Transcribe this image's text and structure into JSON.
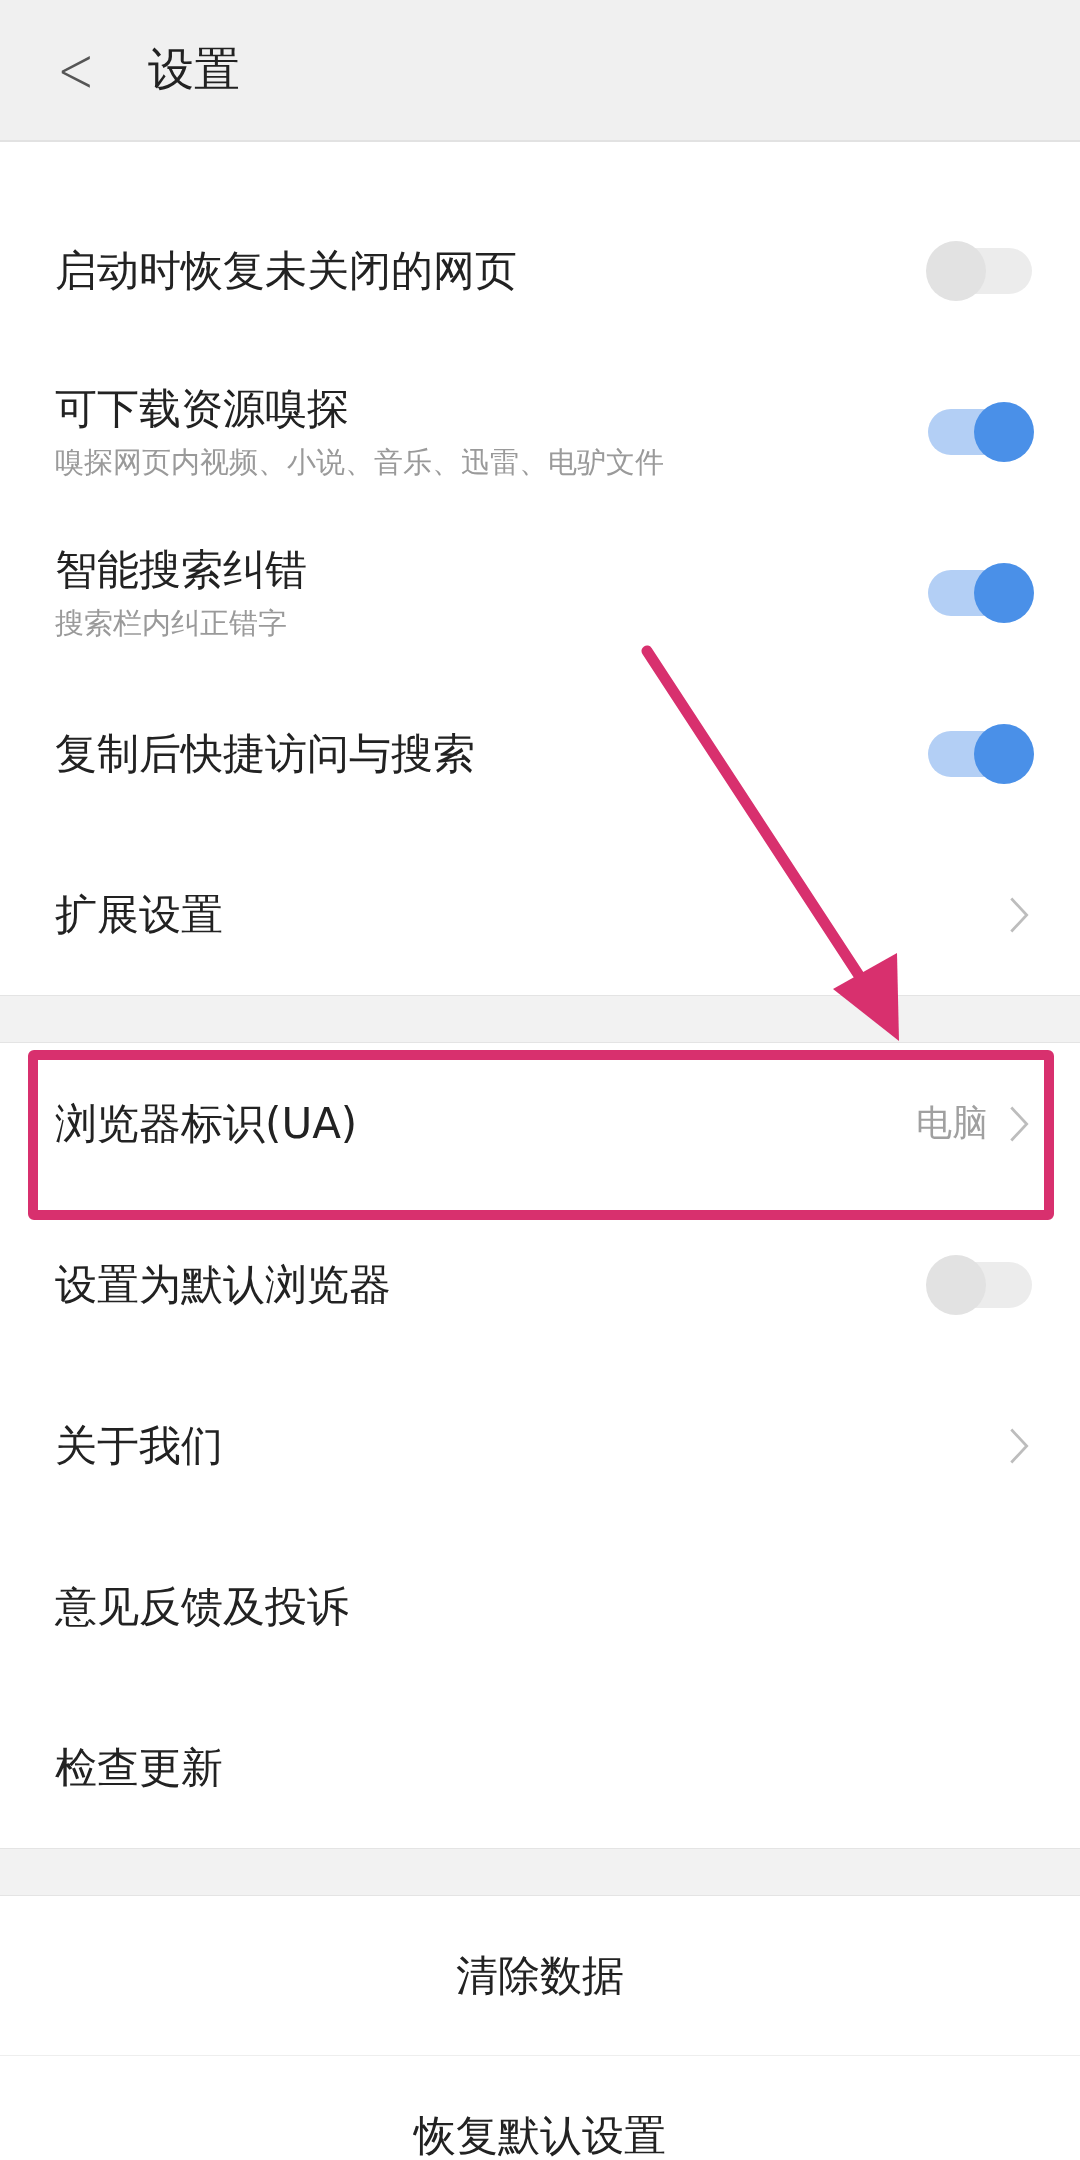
{
  "header": {
    "back": "<",
    "title": "设置"
  },
  "groups": [
    {
      "rows": [
        {
          "kind": "toggle",
          "label": "启动时恢复未关闭的网页",
          "on": false
        },
        {
          "kind": "toggle",
          "label": "可下载资源嗅探",
          "sub": "嗅探网页内视频、小说、音乐、迅雷、电驴文件",
          "on": true
        },
        {
          "kind": "toggle",
          "label": "智能搜索纠错",
          "sub": "搜索栏内纠正错字",
          "on": true
        },
        {
          "kind": "toggle",
          "label": "复制后快捷访问与搜索",
          "on": true
        },
        {
          "kind": "link",
          "label": "扩展设置"
        }
      ]
    },
    {
      "rows": [
        {
          "kind": "link",
          "label": "浏览器标识(UA)",
          "value": "电脑",
          "highlighted": true
        },
        {
          "kind": "toggle",
          "label": "设置为默认浏览器",
          "on": false
        },
        {
          "kind": "link",
          "label": "关于我们"
        },
        {
          "kind": "plain",
          "label": "意见反馈及投诉"
        },
        {
          "kind": "plain",
          "label": "检查更新"
        }
      ]
    }
  ],
  "buttons": [
    "清除数据",
    "恢复默认设置"
  ]
}
